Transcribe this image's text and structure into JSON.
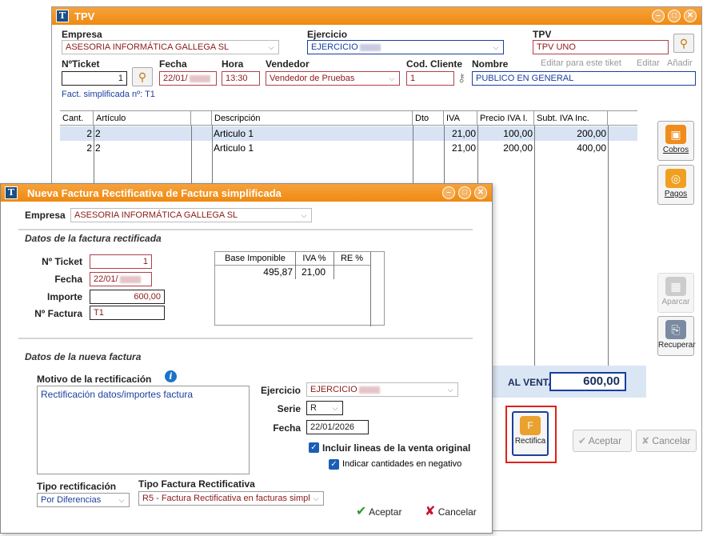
{
  "tpv": {
    "title": "TPV",
    "labels": {
      "empresa": "Empresa",
      "ejercicio": "Ejercicio",
      "tpv": "TPV",
      "nticket": "NºTicket",
      "fecha": "Fecha",
      "hora": "Hora",
      "vendedor": "Vendedor",
      "cod_cliente": "Cod. Cliente",
      "nombre": "Nombre",
      "editar_tiket": "Editar para este tiket",
      "editar": "Editar",
      "anadir": "Añadir"
    },
    "values": {
      "empresa": "ASESORIA INFORMÁTICA GALLEGA SL",
      "ejercicio": "EJERCICIO",
      "tpv": "TPV UNO",
      "nticket": "1",
      "fecha": "22/01/",
      "hora": "13:30",
      "vendedor": "Vendedor de Pruebas",
      "cod_cliente": "1",
      "nombre": "PUBLICO EN GENERAL"
    },
    "fact_simplificada": "Fact. simplificada nº: T1",
    "columns": [
      "Cant.",
      "Artículo",
      "Descripción",
      "Dto",
      "IVA",
      "Precio IVA I.",
      "Subt. IVA Inc."
    ],
    "rows": [
      {
        "cant": "2",
        "articulo": "2",
        "descripcion": "Articulo 1",
        "iva": "21,00",
        "precio": "100,00",
        "subtotal": "200,00"
      },
      {
        "cant": "2",
        "articulo": "2",
        "descripcion": "Articulo 1",
        "iva": "21,00",
        "precio": "200,00",
        "subtotal": "400,00"
      }
    ],
    "side_buttons": {
      "cobros": "Cobros",
      "pagos": "Pagos",
      "aparcar": "Aparcar",
      "recuperar": "Recuperar"
    },
    "total_label": "AL VENTA",
    "total_value": "600,00",
    "rectifica": "Rectifica",
    "aceptar": "Aceptar",
    "cancelar": "Cancelar"
  },
  "dialog": {
    "title": "Nueva Factura Rectificativa de Factura simplificada",
    "empresa_label": "Empresa",
    "empresa_value": "ASESORIA INFORMÁTICA GALLEGA SL",
    "section1": "Datos de la factura rectificada",
    "nticket_label": "Nº Ticket",
    "nticket_value": "1",
    "fecha_label": "Fecha",
    "fecha_value": "22/01/",
    "importe_label": "Importe",
    "importe_value": "600,00",
    "nfactura_label": "Nº Factura",
    "nfactura_value": "T1",
    "iva_columns": [
      "Base Imponible",
      "IVA %",
      "RE %"
    ],
    "iva_row": {
      "base": "495,87",
      "iva": "21,00",
      "re": ""
    },
    "section2": "Datos de la nueva factura",
    "motivo_label": "Motivo de la rectificación",
    "motivo_value": "Rectificación datos/importes factura",
    "ejercicio_label": "Ejercicio",
    "ejercicio_value": "EJERCICIO",
    "serie_label": "Serie",
    "serie_value": "R",
    "fecha2_label": "Fecha",
    "fecha2_value": "22/01/2026",
    "incluir_label": "Incluir lineas de la venta original",
    "indicar_label": "Indicar cantidades en negativo",
    "tipo_rect_label": "Tipo rectificación",
    "tipo_rect_value": "Por Diferencias",
    "tipo_fact_label": "Tipo Factura Rectificativa",
    "tipo_fact_value": "R5 - Factura Rectificativa en facturas simpl",
    "aceptar": "Aceptar",
    "cancelar": "Cancelar"
  },
  "colors": {
    "accent": "#ee8a12",
    "highlight": "#e0201c",
    "link_blue": "#1b3f9e"
  }
}
